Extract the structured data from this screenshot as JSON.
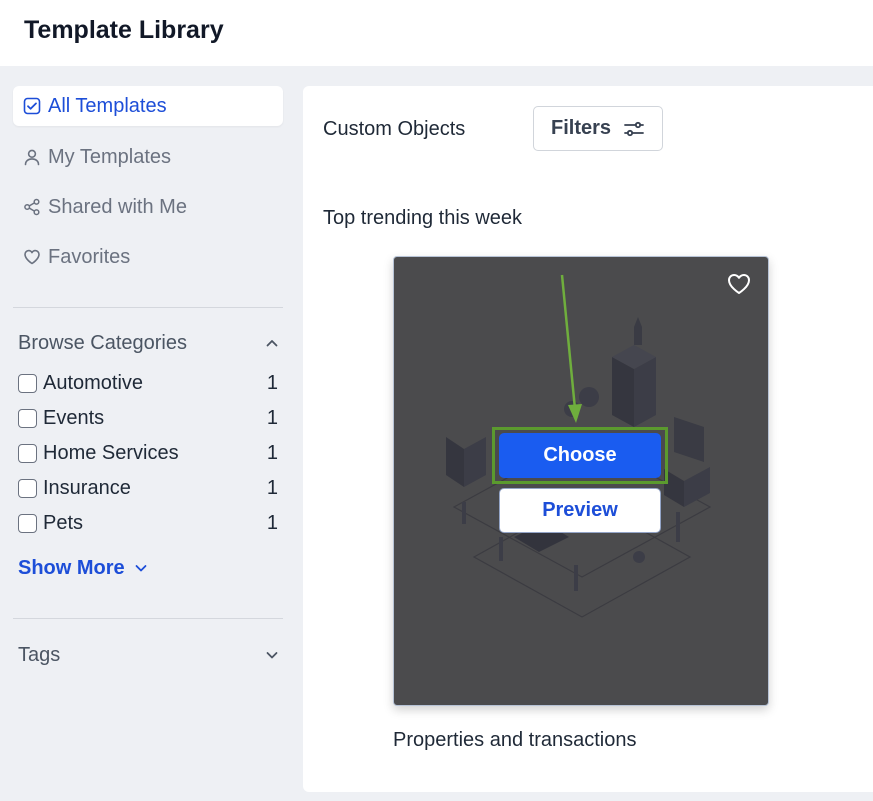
{
  "header": {
    "title": "Template Library"
  },
  "sidebar": {
    "nav": [
      {
        "label": "All Templates",
        "icon": "check-square-icon",
        "active": true
      },
      {
        "label": "My Templates",
        "icon": "user-icon",
        "active": false
      },
      {
        "label": "Shared with Me",
        "icon": "share-icon",
        "active": false
      },
      {
        "label": "Favorites",
        "icon": "heart-icon",
        "active": false
      }
    ],
    "categories": {
      "title": "Browse Categories",
      "items": [
        {
          "label": "Automotive",
          "count": "1"
        },
        {
          "label": "Events",
          "count": "1"
        },
        {
          "label": "Home Services",
          "count": "1"
        },
        {
          "label": "Insurance",
          "count": "1"
        },
        {
          "label": "Pets",
          "count": "1"
        }
      ],
      "show_more": "Show More"
    },
    "tags": {
      "title": "Tags"
    }
  },
  "main": {
    "context": "Custom Objects",
    "filters_label": "Filters",
    "trending_title": "Top trending this week",
    "card": {
      "title": "Properties and transactions",
      "choose_label": "Choose",
      "preview_label": "Preview"
    }
  },
  "colors": {
    "accent": "#1a5cf0",
    "link": "#1d4ed8",
    "highlight_frame": "#5b9a2e",
    "card_overlay": "#4b4b4d"
  }
}
